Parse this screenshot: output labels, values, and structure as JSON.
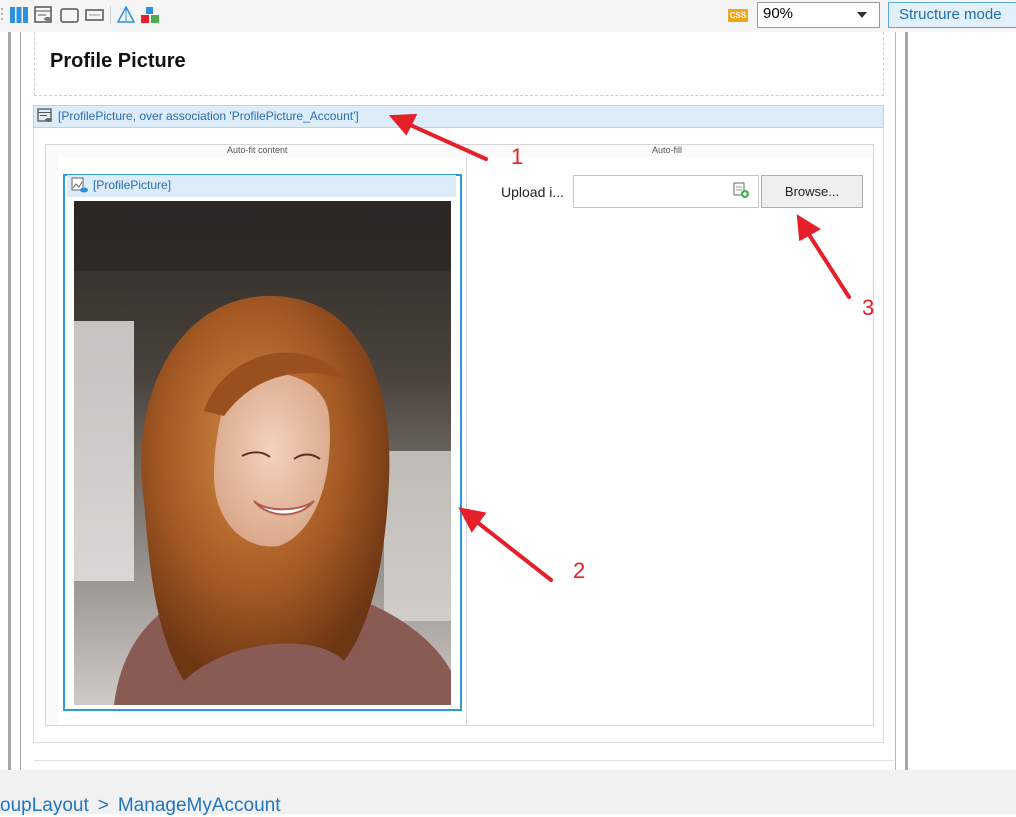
{
  "toolbar": {
    "css_badge": "CSS",
    "zoom": "90%",
    "structure_mode": "Structure mode",
    "icons": [
      "columns-icon",
      "data-view-icon",
      "window-icon",
      "panel-icon",
      "cone-icon",
      "building-blocks-icon",
      "css-icon",
      "dropdown-arrow-icon"
    ]
  },
  "page": {
    "heading": "Profile Picture"
  },
  "dataview": {
    "header": "[ProfilePicture, over association 'ProfilePicture_Account']",
    "left_column_label": "Auto-fit content",
    "right_column_label": "Auto-fill"
  },
  "image_viewer": {
    "header": "[ProfilePicture]"
  },
  "upload": {
    "label": "Upload i...",
    "value": "",
    "browse_label": "Browse..."
  },
  "annotations": {
    "one": "1",
    "two": "2",
    "three": "3",
    "color": "#e6202a"
  },
  "breadcrumb": {
    "items": [
      "oupLayout",
      "ManageMyAccount"
    ],
    "separator": ">"
  },
  "colors": {
    "accent": "#2e9be0",
    "header_bg": "#dcecf9",
    "link": "#1f74c4"
  }
}
